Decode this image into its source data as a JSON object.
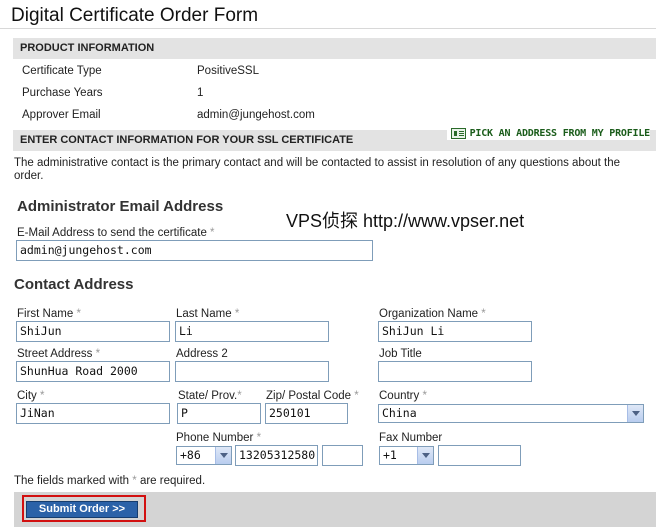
{
  "page": {
    "title": "Digital Certificate Order Form"
  },
  "product": {
    "heading": "PRODUCT INFORMATION",
    "rows": [
      {
        "label": "Certificate Type",
        "value": "PositiveSSL"
      },
      {
        "label": "Purchase Years",
        "value": "1"
      },
      {
        "label": "Approver Email",
        "value": "admin@jungehost.com"
      }
    ]
  },
  "contact_section": {
    "heading": "ENTER CONTACT INFORMATION FOR YOUR SSL CERTIFICATE",
    "pick_link": "PICK AN ADDRESS FROM MY PROFILE",
    "description": "The administrative contact is the primary contact and will be contacted to assist in resolution of any questions about the order."
  },
  "watermark": "VPS侦探 http://www.vpser.net",
  "admin_email": {
    "heading": "Administrator Email Address",
    "label": "E-Mail Address to send the certificate",
    "value": "admin@jungehost.com"
  },
  "contact_address": {
    "heading": "Contact Address",
    "first_name": {
      "label": "First Name",
      "value": "ShiJun"
    },
    "last_name": {
      "label": "Last Name",
      "value": "Li"
    },
    "organization": {
      "label": "Organization Name",
      "value": "ShiJun Li"
    },
    "street": {
      "label": "Street Address",
      "value": "ShunHua Road 2000"
    },
    "address2": {
      "label": "Address 2",
      "value": ""
    },
    "job_title": {
      "label": "Job Title",
      "value": ""
    },
    "city": {
      "label": "City",
      "value": "JiNan"
    },
    "state": {
      "label": "State/ Prov.",
      "value": "P"
    },
    "zip": {
      "label": "Zip/ Postal Code",
      "value": "250101"
    },
    "country": {
      "label": "Country",
      "value": "China"
    },
    "phone": {
      "label": "Phone Number",
      "code": "+86",
      "number": "13205312580",
      "ext": ""
    },
    "fax": {
      "label": "Fax Number",
      "code": "+1",
      "number": ""
    }
  },
  "required_marker": "*",
  "required_note": {
    "prefix": "The fields marked with",
    "suffix": "are required."
  },
  "submit": {
    "label": "Submit Order >>"
  },
  "colors": {
    "submit_bg": "#2b62a8",
    "highlight": "#d21010",
    "pick_link": "#1a5c1a"
  }
}
